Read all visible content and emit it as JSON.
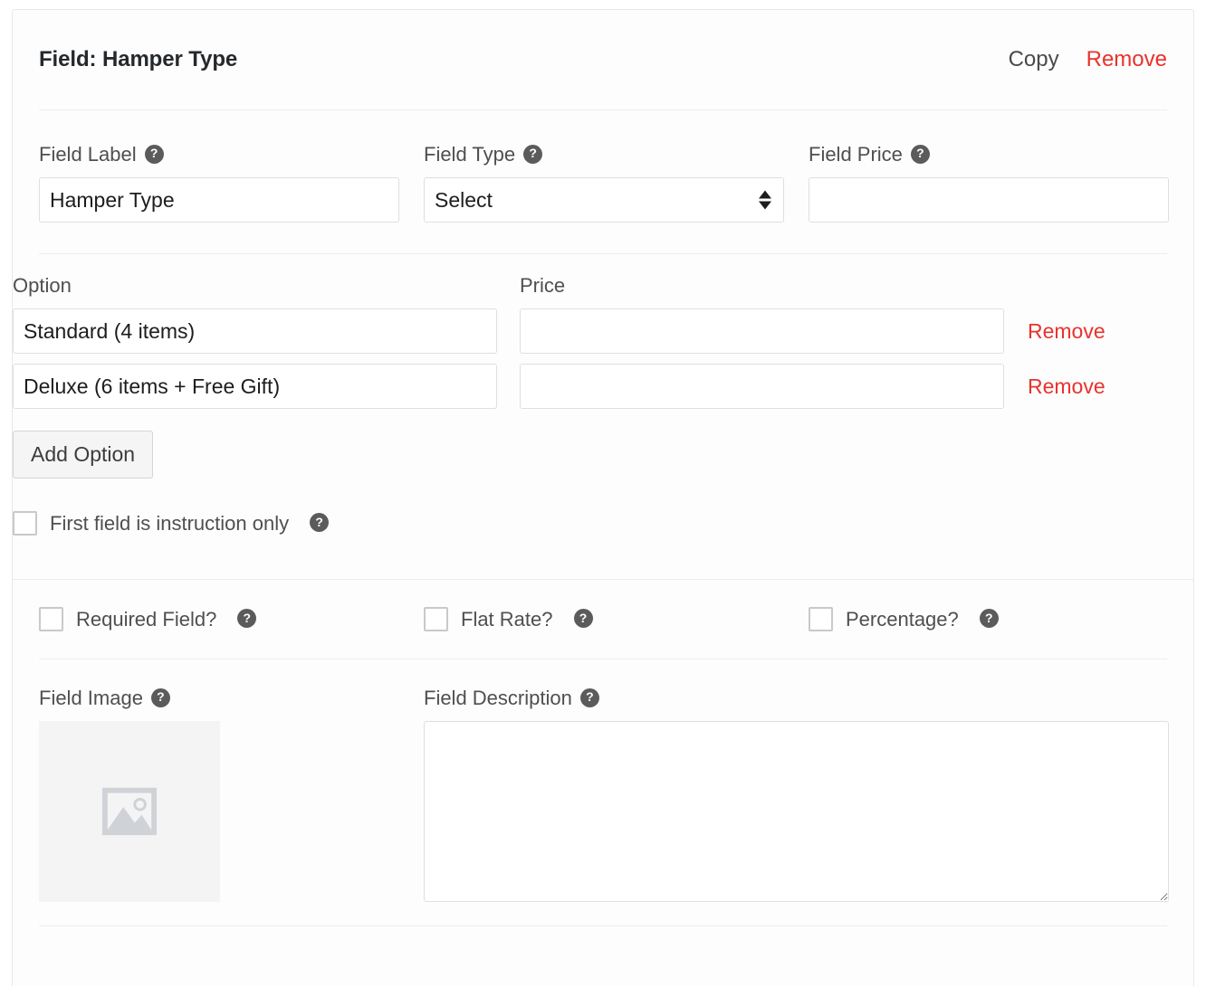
{
  "panel": {
    "title": "Field: Hamper Type",
    "copy_label": "Copy",
    "remove_label": "Remove"
  },
  "help_icon_glyph": "?",
  "fields": {
    "field_label": {
      "label": "Field Label",
      "value": "Hamper Type",
      "placeholder": ""
    },
    "field_type": {
      "label": "Field Type",
      "value": "Select",
      "options": [
        "Select"
      ]
    },
    "field_price": {
      "label": "Field Price",
      "value": "",
      "placeholder": ""
    }
  },
  "options_section": {
    "option_header": "Option",
    "price_header": "Price",
    "rows": [
      {
        "option": "Standard (4 items)",
        "price": "",
        "remove_label": "Remove"
      },
      {
        "option": "Deluxe (6 items + Free Gift)",
        "price": "",
        "remove_label": "Remove"
      }
    ],
    "add_option_label": "Add Option",
    "instruction_only": {
      "label": "First field is instruction only",
      "checked": false
    }
  },
  "flags": [
    {
      "label": "Required Field?",
      "checked": false
    },
    {
      "label": "Flat Rate?",
      "checked": false
    },
    {
      "label": "Percentage?",
      "checked": false
    }
  ],
  "media": {
    "field_image": {
      "label": "Field Image",
      "placeholder_icon": "image-placeholder-icon"
    },
    "field_description": {
      "label": "Field Description",
      "value": "",
      "placeholder": ""
    }
  },
  "colors": {
    "danger": "#e9322d",
    "text": "#4f4f4f",
    "title": "#25292c",
    "border": "#dfdfdf",
    "divider": "#ededed"
  }
}
